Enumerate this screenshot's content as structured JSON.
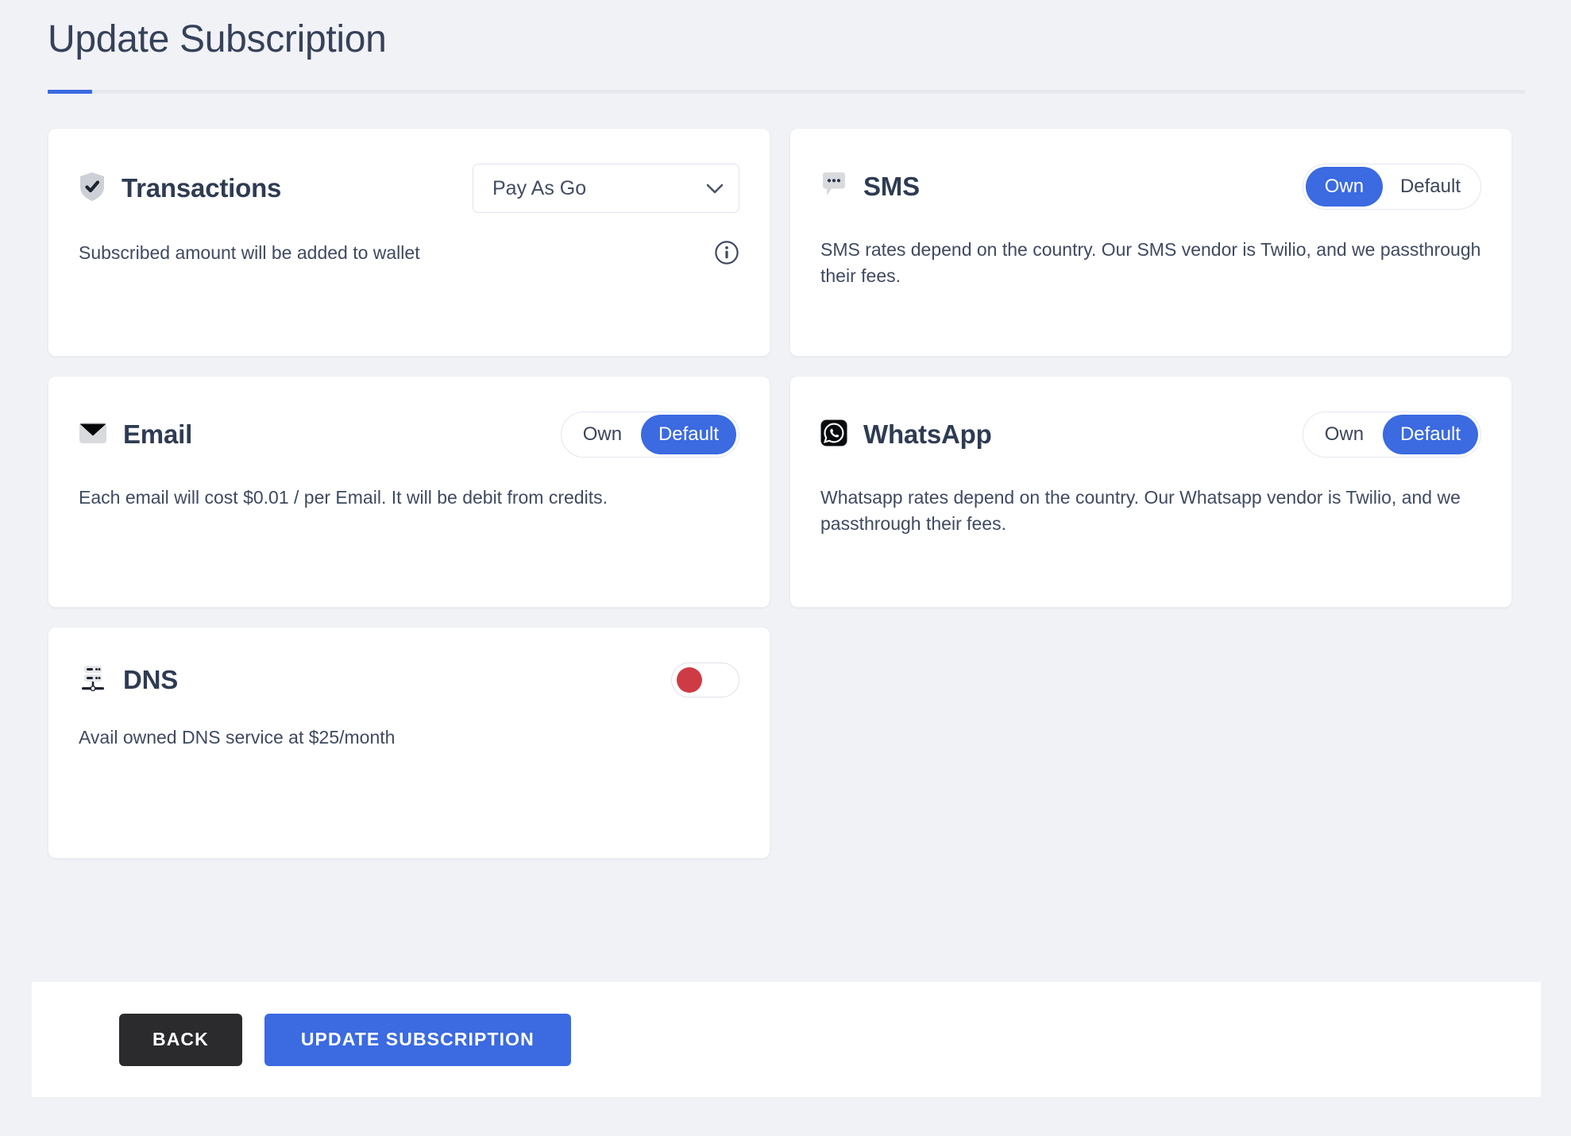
{
  "header": {
    "title": "Update Subscription",
    "accent_color": "#3b6ae1"
  },
  "cards": {
    "transactions": {
      "title": "Transactions",
      "icon": "shield-check-icon",
      "select": {
        "value": "Pay As Go",
        "chevron": "chevron-down-icon"
      },
      "description": "Subscribed amount will be added to wallet",
      "info_icon": "info-circle-icon"
    },
    "sms": {
      "title": "SMS",
      "icon": "chat-bubble-icon",
      "options": [
        "Own",
        "Default"
      ],
      "selected": "Own",
      "description": "SMS rates depend on the country. Our SMS vendor is Twilio, and we passthrough their fees."
    },
    "email": {
      "title": "Email",
      "icon": "envelope-icon",
      "options": [
        "Own",
        "Default"
      ],
      "selected": "Default",
      "description": "Each email will cost $0.01 / per Email. It will be debit from credits."
    },
    "whatsapp": {
      "title": "WhatsApp",
      "icon": "whatsapp-icon",
      "options": [
        "Own",
        "Default"
      ],
      "selected": "Default",
      "description": "Whatsapp rates depend on the country. Our Whatsapp vendor is Twilio, and we passthrough their fees."
    },
    "dns": {
      "title": "DNS",
      "icon": "dns-server-icon",
      "toggle_on": false,
      "toggle_knob_color": "#cf3b45",
      "description": "Avail owned DNS service at $25/month"
    }
  },
  "footer": {
    "back_label": "BACK",
    "update_label": "UPDATE SUBSCRIPTION",
    "back_color": "#2b2b2d",
    "update_color": "#3b6ae1"
  }
}
